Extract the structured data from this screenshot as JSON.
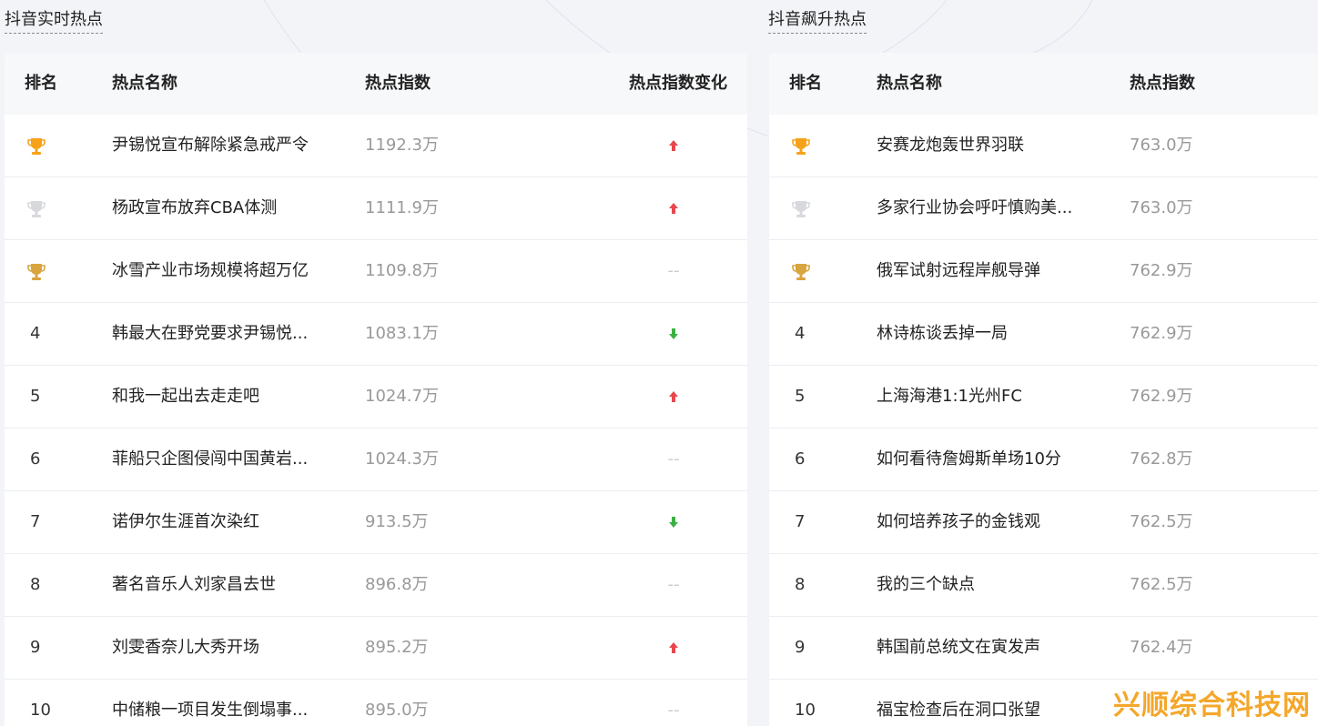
{
  "left_panel": {
    "title": "抖音实时热点",
    "headers": {
      "rank": "排名",
      "name": "热点名称",
      "index": "热点指数",
      "change": "热点指数变化"
    },
    "rows": [
      {
        "rank": "1",
        "name": "尹锡悦宣布解除紧急戒严令",
        "index": "1192.3万",
        "change": "up"
      },
      {
        "rank": "2",
        "name": "杨政宣布放弃CBA体测",
        "index": "1111.9万",
        "change": "up"
      },
      {
        "rank": "3",
        "name": "冰雪产业市场规模将超万亿",
        "index": "1109.8万",
        "change": "--"
      },
      {
        "rank": "4",
        "name": "韩最大在野党要求尹锡悦...",
        "index": "1083.1万",
        "change": "down"
      },
      {
        "rank": "5",
        "name": "和我一起出去走走吧",
        "index": "1024.7万",
        "change": "up"
      },
      {
        "rank": "6",
        "name": "菲船只企图侵闯中国黄岩...",
        "index": "1024.3万",
        "change": "--"
      },
      {
        "rank": "7",
        "name": "诺伊尔生涯首次染红",
        "index": "913.5万",
        "change": "down"
      },
      {
        "rank": "8",
        "name": "著名音乐人刘家昌去世",
        "index": "896.8万",
        "change": "--"
      },
      {
        "rank": "9",
        "name": "刘雯香奈儿大秀开场",
        "index": "895.2万",
        "change": "up"
      },
      {
        "rank": "10",
        "name": "中储粮一项目发生倒塌事...",
        "index": "895.0万",
        "change": "--"
      }
    ]
  },
  "right_panel": {
    "title": "抖音飙升热点",
    "headers": {
      "rank": "排名",
      "name": "热点名称",
      "index": "热点指数"
    },
    "rows": [
      {
        "rank": "1",
        "name": "安赛龙炮轰世界羽联",
        "index": "763.0万"
      },
      {
        "rank": "2",
        "name": "多家行业协会呼吁慎购美...",
        "index": "763.0万"
      },
      {
        "rank": "3",
        "name": "俄军试射远程岸舰导弹",
        "index": "762.9万"
      },
      {
        "rank": "4",
        "name": "林诗栋谈丢掉一局",
        "index": "762.9万"
      },
      {
        "rank": "5",
        "name": "上海海港1:1光州FC",
        "index": "762.9万"
      },
      {
        "rank": "6",
        "name": "如何看待詹姆斯单场10分",
        "index": "762.8万"
      },
      {
        "rank": "7",
        "name": "如何培养孩子的金钱观",
        "index": "762.5万"
      },
      {
        "rank": "8",
        "name": "我的三个缺点",
        "index": "762.5万"
      },
      {
        "rank": "9",
        "name": "韩国前总统文在寅发声",
        "index": "762.4万"
      },
      {
        "rank": "10",
        "name": "福宝检查后在洞口张望",
        "index": ""
      }
    ]
  },
  "trophy_icons": [
    "gold-trophy-icon",
    "silver-trophy-icon",
    "bronze-trophy-icon"
  ],
  "change_icons": {
    "up": "arrow-up-icon",
    "down": "arrow-down-icon",
    "--": "no-change-dash"
  },
  "colors": {
    "gold": "#f5a21a",
    "silver": "#d7d9dd",
    "bronze": "#d9a53e",
    "up": "#e8474c",
    "down": "#3cb043",
    "index_text": "#999999",
    "watermark": "#f4a72b"
  },
  "watermark": "兴顺综合科技网"
}
